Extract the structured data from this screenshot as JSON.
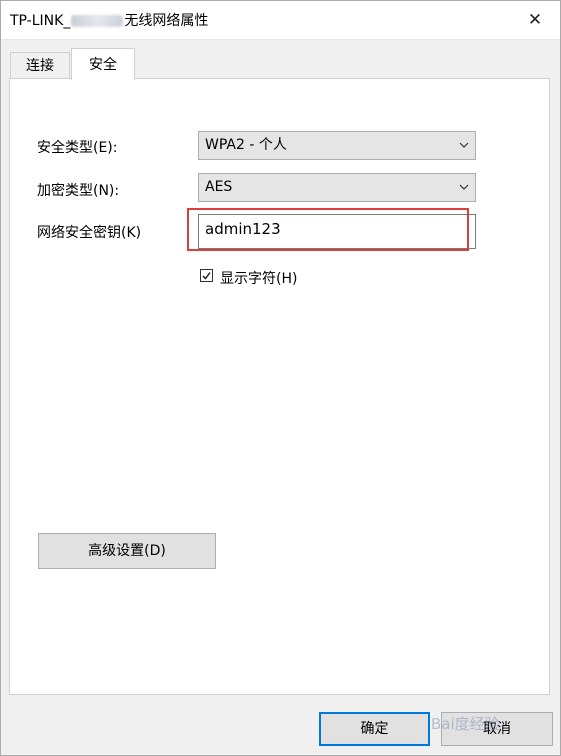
{
  "window": {
    "title_prefix": "TP-LINK_",
    "title_suffix": "无线网络属性",
    "close_glyph": "✕"
  },
  "tabs": [
    {
      "label": "连接"
    },
    {
      "label": "安全"
    }
  ],
  "form": {
    "security_type_label": "安全类型(E):",
    "security_type_value": "WPA2 - 个人",
    "encryption_type_label": "加密类型(N):",
    "encryption_type_value": "AES",
    "network_key_label": "网络安全密钥(K)",
    "network_key_value": "admin123",
    "show_chars_label": "显示字符(H)",
    "show_chars_checked": true
  },
  "buttons": {
    "advanced": "高级设置(D)",
    "ok": "确定",
    "cancel": "取消"
  },
  "watermark": "Bai度经验",
  "colors": {
    "highlight": "#d9403c",
    "accent": "#0078d7"
  }
}
